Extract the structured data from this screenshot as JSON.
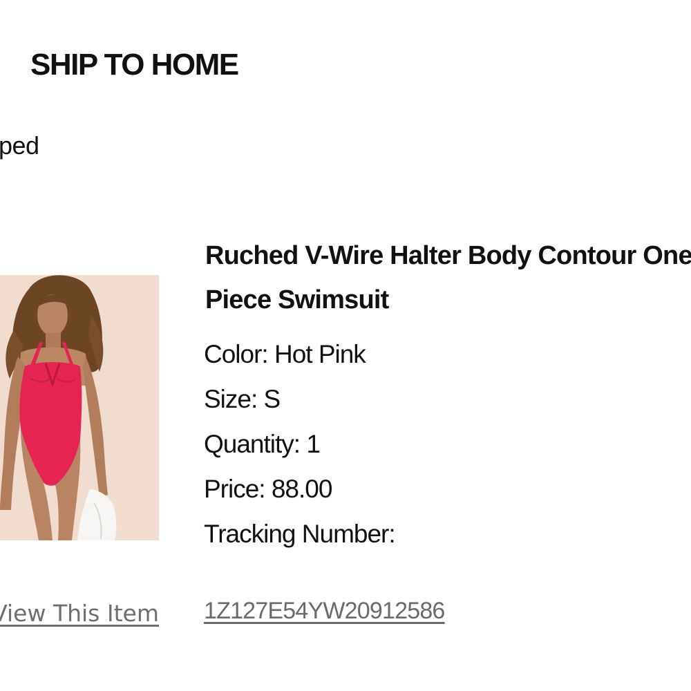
{
  "section": {
    "title": "SHIP TO HOME",
    "status": "ped"
  },
  "product": {
    "image_alt": "Model wearing hot pink one-piece swimsuit",
    "name": "Ruched V-Wire Halter Body Contour One-Piece Swimsuit",
    "color": "Color: Hot Pink",
    "size": "Size: S",
    "quantity": "Quantity: 1",
    "price": "Price: 88.00",
    "tracking_label": "Tracking Number:",
    "tracking_number": "1Z127E54YW20912586",
    "view_item_label": "View This Item"
  },
  "colors": {
    "swimsuit": "#e52451",
    "background": "#f1ddd0",
    "link": "#6e6e6e"
  }
}
